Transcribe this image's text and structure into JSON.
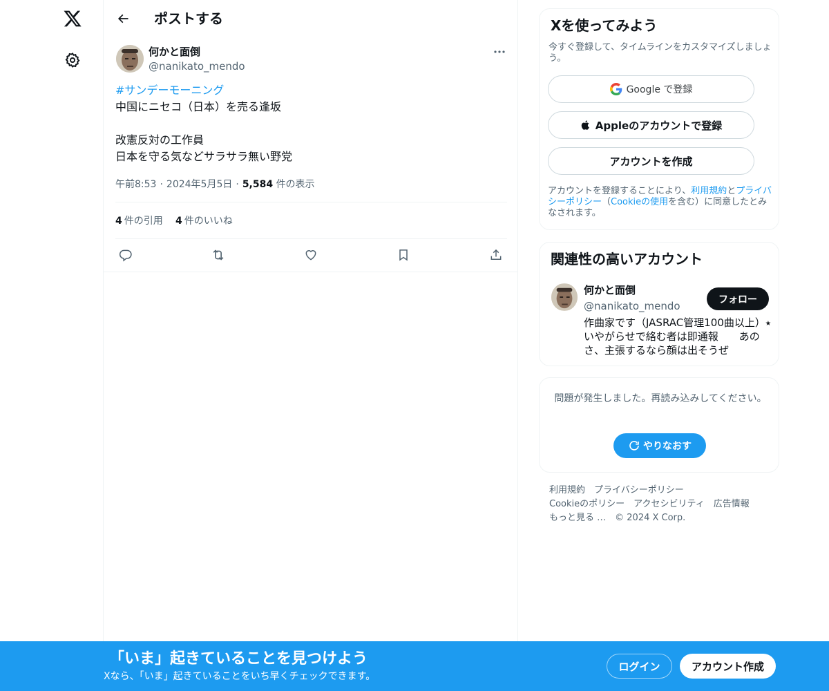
{
  "header": {
    "title": "ポストする"
  },
  "post": {
    "author_name": "何かと面倒",
    "author_handle": "@nanikato_mendo",
    "hashtag": "#サンデーモーニング",
    "lines": [
      "中国にニセコ（日本）を売る逢坂",
      "改憲反対の工作員",
      "日本を守る気などサラサラ無い野党"
    ],
    "time": "午前8:53",
    "date": "2024年5月5日",
    "views_count": "5,584",
    "views_label": "件の表示",
    "quotes_count": "4",
    "quotes_label": "件の引用",
    "likes_count": "4",
    "likes_label": "件のいいね"
  },
  "signup_card": {
    "title": "Xを使ってみよう",
    "subtitle": "今すぐ登録して、タイムラインをカスタマイズしましょう。",
    "google_label": "Google で登録",
    "apple_label": "Appleのアカウントで登録",
    "create_label": "アカウントを作成",
    "legal_prefix": "アカウントを登録することにより、",
    "terms_link": "利用規約",
    "legal_and": "と",
    "privacy_link": "プライバシーポリシー",
    "legal_paren_open": "（",
    "cookie_link": "Cookieの使用",
    "legal_suffix": "を含む）に同意したとみなされます。"
  },
  "related_card": {
    "title": "関連性の高いアカウント",
    "name": "何かと面倒",
    "handle": "@nanikato_mendo",
    "follow_label": "フォロー",
    "bio": "作曲家です（JASRAC管理100曲以上）⭑ いやがらせで絡む者は即通報　　あのさ、主張するなら顔は出そうぜ"
  },
  "error_card": {
    "message": "問題が発生しました。再読み込みしてください。",
    "retry_label": "やりなおす"
  },
  "footer": {
    "terms": "利用規約",
    "privacy": "プライバシーポリシー",
    "cookie": "Cookieのポリシー",
    "accessibility": "アクセシビリティ",
    "ads": "広告情報",
    "more": "もっと見る …",
    "copyright": "© 2024 X Corp."
  },
  "banner": {
    "title": "「いま」起きていることを見つけよう",
    "subtitle": "Xなら、「いま」起きていることをいち早くチェックできます。",
    "login_label": "ログイン",
    "signup_label": "アカウント作成"
  },
  "colors": {
    "accent": "#1d9bf0",
    "text": "#0f1419",
    "secondary": "#536471",
    "border": "#eff3f4"
  },
  "icons": [
    "x-logo-icon",
    "gear-icon",
    "back-arrow-icon",
    "more-icon",
    "reply-icon",
    "repost-icon",
    "like-icon",
    "bookmark-icon",
    "share-icon",
    "google-icon",
    "apple-icon",
    "refresh-icon"
  ]
}
